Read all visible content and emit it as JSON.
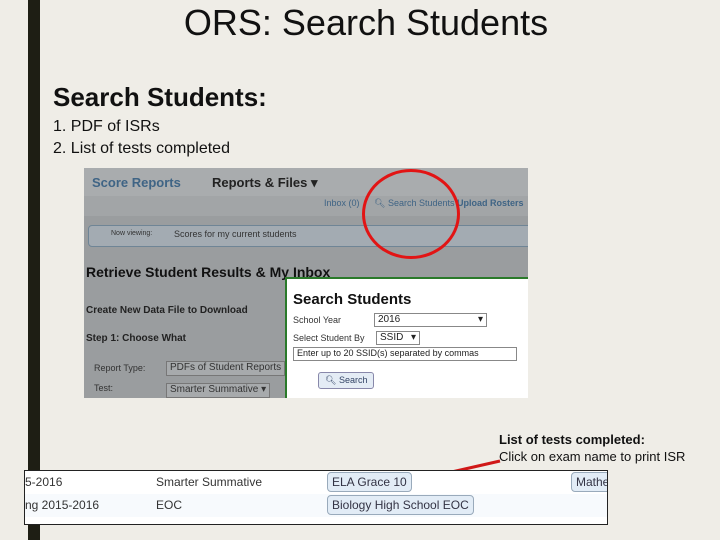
{
  "title": "ORS: Search Students",
  "subtitle": "Search Students:",
  "list": [
    "1. PDF of ISRs",
    "2. List of tests completed"
  ],
  "screenshot": {
    "nav": {
      "score_reports": "Score Reports",
      "reports_files": "Reports & Files ▾",
      "inbox": "Inbox (0)",
      "search_students": "Search Students",
      "upload_rosters": "Upload Rosters"
    },
    "viewing_label": "Now viewing:",
    "viewing_value": "Scores for my current students",
    "heading": "Retrieve Student Results & My Inbox",
    "create": "Create New Data File to Download",
    "step1": "Step 1: Choose What",
    "report_type_label": "Report Type:",
    "report_type_value": "PDFs of Student Reports",
    "test_label": "Test:",
    "test_value": "Smarter Summative ▾",
    "modal": {
      "title": "Search Students",
      "school_year_label": "School Year",
      "school_year_value": "2016",
      "select_by_label": "Select Student By",
      "select_by_value": "SSID",
      "ssid_placeholder": "Enter up to 20 SSID(s) separated by commas",
      "search_button": "Search"
    }
  },
  "note": {
    "title": "List of tests completed:",
    "text": "Click on exam name to print ISR"
  },
  "table": [
    {
      "year": "5-2016",
      "type": "Smarter Summative",
      "exam": "ELA Grace 10",
      "exam2": "Mathe"
    },
    {
      "year": "ng 2015-2016",
      "type": "EOC",
      "exam": "Biology High School EOC"
    }
  ]
}
